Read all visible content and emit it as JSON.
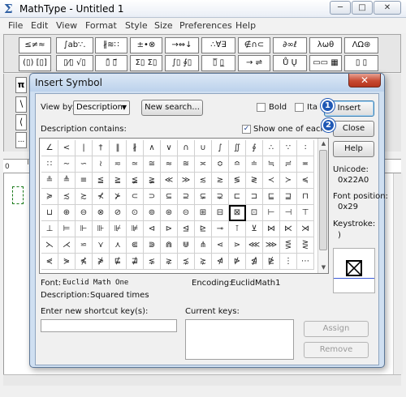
{
  "main_window": {
    "title": "MathType - Untitled 1",
    "caption_buttons": {
      "minimize": "─",
      "maximize": "□",
      "close": "✕"
    },
    "menu": [
      "File",
      "Edit",
      "View",
      "Format",
      "Style",
      "Size",
      "Preferences",
      "Help"
    ],
    "palette_row1": [
      "≤≠≈",
      "∫ab∵.",
      "∦≋∷",
      "±•⊗",
      "→⇔↓",
      "∴∀∃",
      "∉∩⊂",
      "∂∞ℓ",
      "λωθ",
      "ΛΩ⊛"
    ],
    "palette_row2": [
      "(▯) [▯]",
      "▯⁄▯ √▯",
      "▯̄ ▯⃗",
      "Σ▯ Σ▯",
      "∫▯ ∮▯",
      "▯̅ ▯̲",
      "→ ⇌",
      "Ů Ų",
      "▭▭ ▦",
      "▯ ▯"
    ],
    "palette_left": [
      "π",
      "∖",
      "⟨",
      "..."
    ],
    "ruler_marks": [
      "0",
      "1",
      "2"
    ]
  },
  "dialog": {
    "title": "Insert Symbol",
    "close_label": "✕",
    "view_by_label": "View by:",
    "view_by_value": "Description",
    "new_search_label": "New search...",
    "bold_label": "Bold",
    "bold_checked": false,
    "italic_label": "Italic",
    "italic_checked": false,
    "insert_label": "Insert",
    "close_button_label": "Close",
    "help_label": "Help",
    "description_contains_label": "Description contains:",
    "show_one_label": "Show one of each",
    "show_one_checked": true,
    "unicode_label": "Unicode:",
    "unicode_value": "0x22A0",
    "font_position_label": "Font position:",
    "font_position_value": "0x29",
    "keystroke_label": "Keystroke:",
    "keystroke_value": ")",
    "font_label": "Font:",
    "font_value": "Euclid Math One",
    "encoding_label": "Encoding:",
    "encoding_value": "EuclidMath1",
    "description_label": "Description:",
    "description_value": "Squared times",
    "shortcut_label": "Enter new shortcut key(s):",
    "shortcut_value": "",
    "current_keys_label": "Current keys:",
    "assign_label": "Assign",
    "remove_label": "Remove",
    "annotations": [
      "1",
      "2"
    ]
  },
  "symbol_grid": [
    [
      "∠",
      "<",
      "|",
      "†",
      "‖",
      "∦",
      "∧",
      "∨",
      "∩",
      "∪",
      "∫",
      "∬",
      "∮",
      "∴",
      "∵",
      "∶"
    ],
    [
      "∷",
      "∼",
      "∽",
      "≀",
      "≂",
      "≃",
      "≅",
      "≈",
      "≊",
      "≍",
      "≎",
      "≏",
      "≐",
      "≒",
      "≓",
      "≖"
    ],
    [
      "≗",
      "≜",
      "≡",
      "≦",
      "≧",
      "≨",
      "≩",
      "≪",
      "≫",
      "≲",
      "≳",
      "≶",
      "≷",
      "≺",
      "≻",
      "≼"
    ],
    [
      "≽",
      "≾",
      "≿",
      "⊀",
      "⊁",
      "⊂",
      "⊃",
      "⊆",
      "⊇",
      "⊊",
      "⊋",
      "⊏",
      "⊐",
      "⊑",
      "⊒",
      "⊓"
    ],
    [
      "⊔",
      "⊕",
      "⊖",
      "⊗",
      "⊘",
      "⊙",
      "⊚",
      "⊛",
      "⊝",
      "⊞",
      "⊟",
      "⊠",
      "⊡",
      "⊢",
      "⊣",
      "⊤"
    ],
    [
      "⊥",
      "⊨",
      "⊩",
      "⊪",
      "⊮",
      "⊯",
      "⊲",
      "⊳",
      "⊴",
      "⊵",
      "⊸",
      "⊺",
      "⊻",
      "⋈",
      "⋉",
      "⋊"
    ],
    [
      "⋋",
      "⋌",
      "⋍",
      "⋎",
      "⋏",
      "⋐",
      "⋑",
      "⋒",
      "⋓",
      "⋔",
      "⋖",
      "⋗",
      "⋘",
      "⋙",
      "⋚",
      "⋛"
    ],
    [
      "⋞",
      "⋟",
      "⋠",
      "⋡",
      "⋢",
      "⋣",
      "⋦",
      "⋧",
      "⋨",
      "⋩",
      "⋪",
      "⋫",
      "⋬",
      "⋭",
      "⋮",
      "⋯"
    ]
  ],
  "selected_symbol": "⊠"
}
